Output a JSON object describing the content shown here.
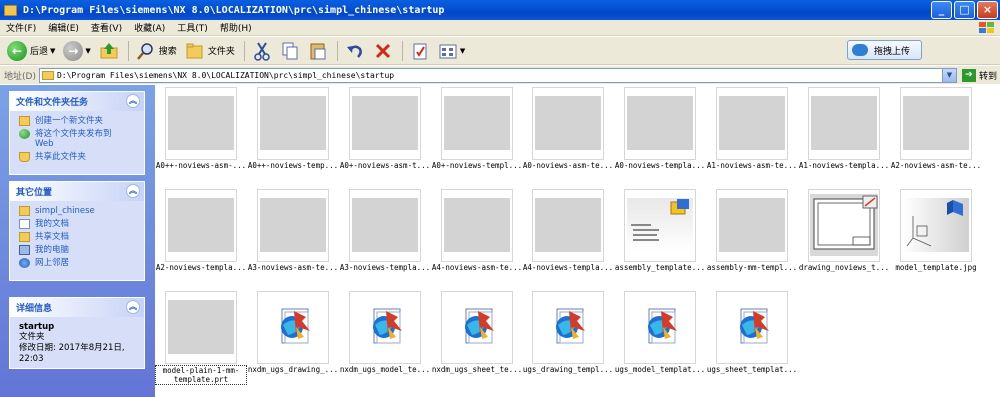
{
  "window": {
    "title": "D:\\Program Files\\siemens\\NX 8.0\\LOCALIZATION\\prc\\simpl_chinese\\startup",
    "buttons": {
      "minimize": "_",
      "maximize": "□",
      "close": "×"
    }
  },
  "menu": [
    "文件(F)",
    "编辑(E)",
    "查看(V)",
    "收藏(A)",
    "工具(T)",
    "帮助(H)"
  ],
  "toolbar": {
    "back_label": "后退",
    "search_label": "搜索",
    "folders_label": "文件夹",
    "upload_label": "拖拽上传"
  },
  "address": {
    "label": "地址(D)",
    "path": "D:\\Program Files\\siemens\\NX 8.0\\LOCALIZATION\\prc\\simpl_chinese\\startup",
    "go_label": "转到"
  },
  "sidebar": {
    "file_tasks": {
      "title": "文件和文件夹任务",
      "items": [
        "创建一个新文件夹",
        "将这个文件夹发布到\nWeb",
        "共享此文件夹"
      ]
    },
    "other_places": {
      "title": "其它位置",
      "items": [
        "simpl_chinese",
        "我的文档",
        "共享文档",
        "我的电脑",
        "网上邻居"
      ]
    },
    "details": {
      "title": "详细信息",
      "name": "startup",
      "type": "文件夹",
      "modified": "修改日期: 2017年8月21日,\n22:03"
    }
  },
  "files": [
    {
      "name": "A0++-noviews-asm-...",
      "kind": "gray"
    },
    {
      "name": "A0++-noviews-temp...",
      "kind": "gray"
    },
    {
      "name": "A0+-noviews-asm-t...",
      "kind": "gray"
    },
    {
      "name": "A0+-noviews-templ...",
      "kind": "gray"
    },
    {
      "name": "A0-noviews-asm-te...",
      "kind": "gray"
    },
    {
      "name": "A0-noviews-templa...",
      "kind": "gray"
    },
    {
      "name": "A1-noviews-asm-te...",
      "kind": "gray"
    },
    {
      "name": "A1-noviews-templa...",
      "kind": "gray"
    },
    {
      "name": "A2-noviews-asm-te...",
      "kind": "gray"
    },
    {
      "name": "A2-noviews-templa...",
      "kind": "gray"
    },
    {
      "name": "A3-noviews-asm-te...",
      "kind": "gray"
    },
    {
      "name": "A3-noviews-templa...",
      "kind": "gray"
    },
    {
      "name": "A4-noviews-asm-te...",
      "kind": "gray"
    },
    {
      "name": "A4-noviews-templa...",
      "kind": "gray"
    },
    {
      "name": "assembly_template...",
      "kind": "assembly"
    },
    {
      "name": "assembly-mm-templ...",
      "kind": "gray"
    },
    {
      "name": "drawing_noviews_t...",
      "kind": "drawing"
    },
    {
      "name": "model_template.jpg",
      "kind": "model"
    },
    {
      "name": "model-plain-1-mm-template.prt",
      "kind": "gray",
      "selected": true
    },
    {
      "name": "nxdm_ugs_drawing_...",
      "kind": "ugs"
    },
    {
      "name": "nxdm_ugs_model_te...",
      "kind": "ugs"
    },
    {
      "name": "nxdm_ugs_sheet_te...",
      "kind": "ugs"
    },
    {
      "name": "ugs_drawing_templ...",
      "kind": "ugs"
    },
    {
      "name": "ugs_model_templat...",
      "kind": "ugs"
    },
    {
      "name": "ugs_sheet_templat...",
      "kind": "ugs"
    }
  ]
}
